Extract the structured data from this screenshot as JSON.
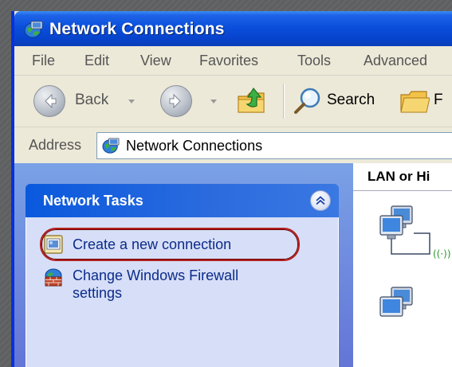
{
  "window": {
    "title": "Network Connections"
  },
  "menu": {
    "items": [
      "File",
      "Edit",
      "View",
      "Favorites",
      "Tools",
      "Advanced"
    ]
  },
  "toolbar": {
    "back_label": "Back",
    "search_label": "Search",
    "folders_label_partial": "F"
  },
  "address": {
    "label": "Address",
    "value": "Network Connections"
  },
  "task_panel": {
    "title": "Network Tasks",
    "items": [
      {
        "label": "Create a new connection",
        "icon": "new-connection-icon"
      },
      {
        "label": "Change Windows Firewall settings",
        "icon": "firewall-icon"
      }
    ]
  },
  "list": {
    "group_header": "LAN or Hi"
  },
  "colors": {
    "titlebar": "#0a4fdc",
    "taskbody": "#d6dff7",
    "link": "#0c2a8a",
    "highlight": "#b32020"
  }
}
